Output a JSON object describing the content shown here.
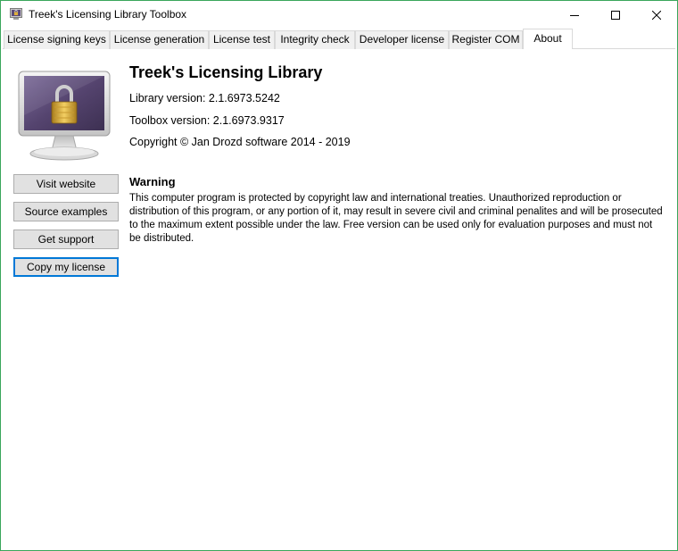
{
  "window": {
    "title": "Treek's Licensing Library Toolbox",
    "accent_border": "#3aa65b"
  },
  "tabs": [
    {
      "label": "License signing keys",
      "active": false
    },
    {
      "label": "License generation",
      "active": false
    },
    {
      "label": "License test",
      "active": false
    },
    {
      "label": "Integrity check",
      "active": false
    },
    {
      "label": "Developer license",
      "active": false
    },
    {
      "label": "Register COM",
      "active": false
    },
    {
      "label": "About",
      "active": true
    }
  ],
  "about": {
    "product_name": "Treek's Licensing Library",
    "library_version": "Library version: 2.1.6973.5242",
    "toolbox_version": "Toolbox version: 2.1.6973.9317",
    "copyright": "Copyright © Jan Drozd software 2014 - 2019",
    "warning_title": "Warning",
    "warning_text": "This computer program is protected by copyright law and international treaties. Unauthorized reproduction or distribution of this program, or any portion of it, may result in severe civil and criminal penalites and will be prosecuted to the maximum extent possible under the law. Free version can be used only for evaluation purposes and must not be distributed."
  },
  "buttons": {
    "visit_website": "Visit website",
    "source_examples": "Source examples",
    "get_support": "Get support",
    "copy_license": "Copy my license"
  },
  "icons": {
    "app": "lock-monitor-icon",
    "logo": "monitor-padlock-icon"
  },
  "colors": {
    "focus_border": "#0078d7",
    "screen_purple": "#5b4a78"
  }
}
